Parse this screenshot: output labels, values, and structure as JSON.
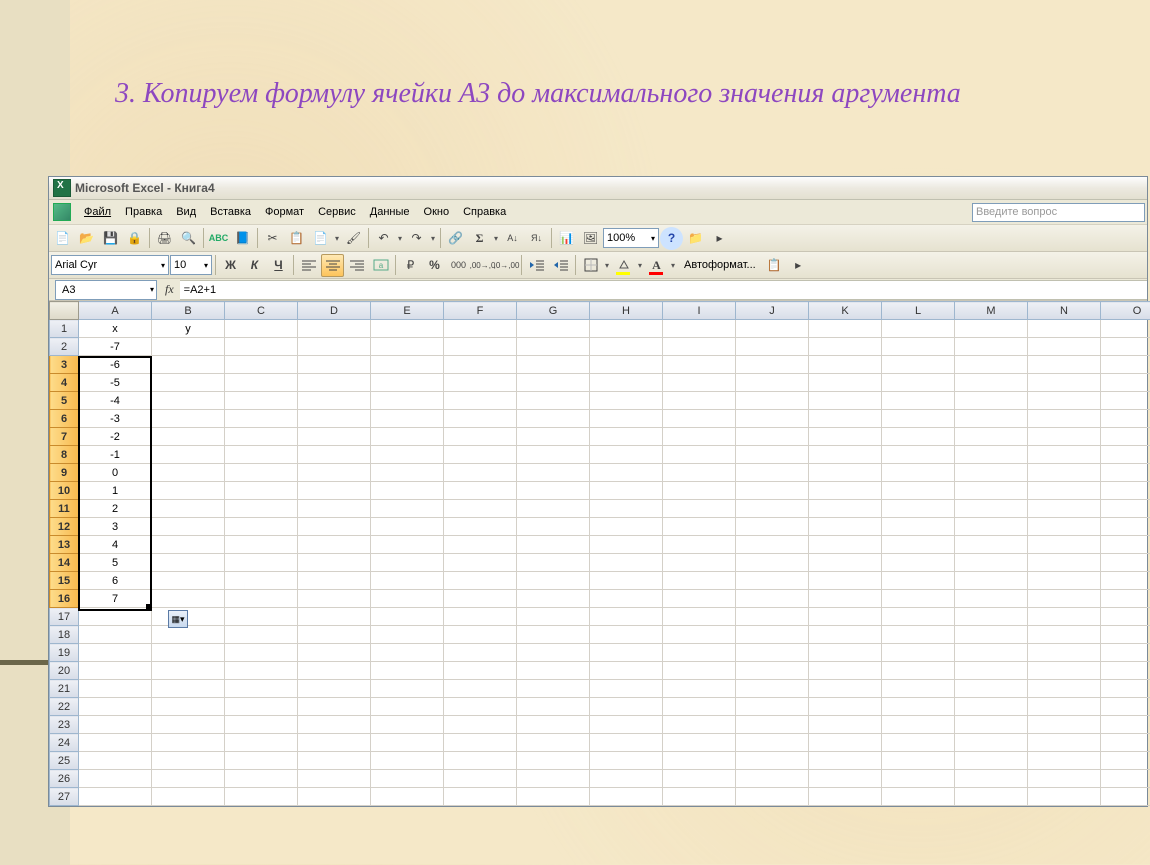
{
  "slide": {
    "title": "3. Копируем формулу ячейки А3 до максимального значения аргумента"
  },
  "titlebar": {
    "text": "Microsoft Excel - Книга4"
  },
  "menubar": {
    "items": [
      "Файл",
      "Правка",
      "Вид",
      "Вставка",
      "Формат",
      "Сервис",
      "Данные",
      "Окно",
      "Справка"
    ],
    "help_placeholder": "Введите вопрос"
  },
  "toolbar1": {
    "zoom": "100%"
  },
  "toolbar2": {
    "font": "Arial Cyr",
    "size": "10",
    "bold": "Ж",
    "italic": "К",
    "underline": "Ч",
    "currency": "%",
    "autoformat": "Автоформат..."
  },
  "formula": {
    "cell": "A3",
    "fx": "fx",
    "value": "=A2+1"
  },
  "grid": {
    "columns": [
      "A",
      "B",
      "C",
      "D",
      "E",
      "F",
      "G",
      "H",
      "I",
      "J",
      "K",
      "L",
      "M",
      "N",
      "O"
    ],
    "rows": [
      {
        "n": 1,
        "sel": false,
        "A": "x",
        "B": "y"
      },
      {
        "n": 2,
        "sel": false,
        "A": "-7"
      },
      {
        "n": 3,
        "sel": true,
        "A": "-6"
      },
      {
        "n": 4,
        "sel": true,
        "A": "-5"
      },
      {
        "n": 5,
        "sel": true,
        "A": "-4"
      },
      {
        "n": 6,
        "sel": true,
        "A": "-3"
      },
      {
        "n": 7,
        "sel": true,
        "A": "-2"
      },
      {
        "n": 8,
        "sel": true,
        "A": "-1"
      },
      {
        "n": 9,
        "sel": true,
        "A": "0"
      },
      {
        "n": 10,
        "sel": true,
        "A": "1"
      },
      {
        "n": 11,
        "sel": true,
        "A": "2"
      },
      {
        "n": 12,
        "sel": true,
        "A": "3"
      },
      {
        "n": 13,
        "sel": true,
        "A": "4"
      },
      {
        "n": 14,
        "sel": true,
        "A": "5"
      },
      {
        "n": 15,
        "sel": true,
        "A": "6"
      },
      {
        "n": 16,
        "sel": true,
        "A": "7"
      },
      {
        "n": 17,
        "sel": false
      },
      {
        "n": 18,
        "sel": false
      },
      {
        "n": 19,
        "sel": false
      },
      {
        "n": 20,
        "sel": false
      },
      {
        "n": 21,
        "sel": false
      },
      {
        "n": 22,
        "sel": false
      },
      {
        "n": 23,
        "sel": false
      },
      {
        "n": 24,
        "sel": false
      },
      {
        "n": 25,
        "sel": false
      },
      {
        "n": 26,
        "sel": false
      },
      {
        "n": 27,
        "sel": false
      }
    ]
  }
}
